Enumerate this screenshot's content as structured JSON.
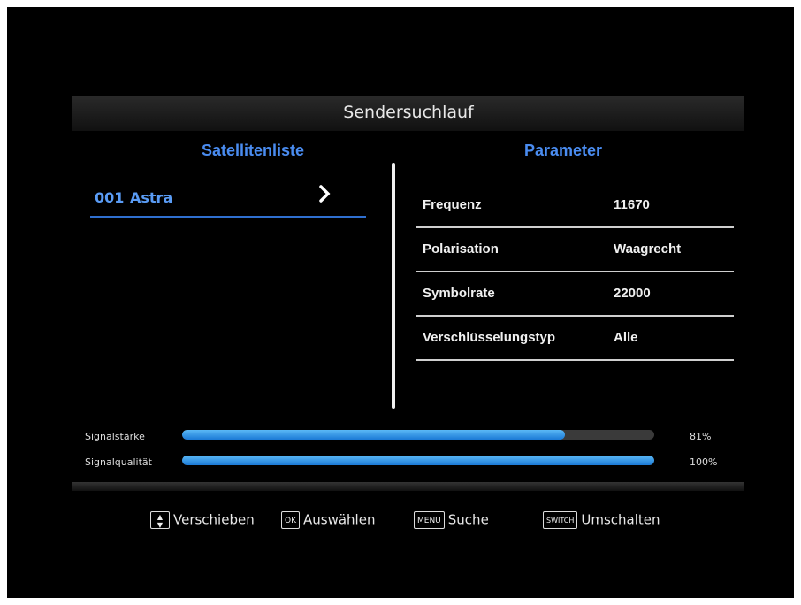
{
  "title": "Sendersuchlauf",
  "satellite": {
    "heading": "Satellitenliste",
    "items": [
      {
        "number": "001",
        "name": "Astra",
        "arrow": "›"
      }
    ]
  },
  "parameter": {
    "heading": "Parameter",
    "rows": [
      {
        "label": "Frequenz",
        "value": "11670"
      },
      {
        "label": "Polarisation",
        "value": "Waagrecht"
      },
      {
        "label": "Symbolrate",
        "value": "22000"
      },
      {
        "label": "Verschlüsselungstyp",
        "value": "Alle"
      }
    ]
  },
  "signal": {
    "strength": {
      "label": "Signalstärke",
      "percent_text": "81%",
      "fraction": 0.81
    },
    "quality": {
      "label": "Signalqualität",
      "percent_text": "100%",
      "fraction": 1.0
    }
  },
  "footer": {
    "hints": [
      {
        "key": "▲▼",
        "key_icon": "up-down-arrows-key",
        "label": "Verschieben"
      },
      {
        "key": "OK",
        "key_icon": "ok-key",
        "label": "Auswählen"
      },
      {
        "key": "MENU",
        "key_icon": "menu-key",
        "label": "Suche"
      },
      {
        "key": "SWITCH",
        "key_icon": "switch-key",
        "label": "Umschalten"
      }
    ]
  },
  "colors": {
    "accent": "#4a8cf0",
    "bar_fill": "#1b7ad6",
    "background": "#000000"
  }
}
